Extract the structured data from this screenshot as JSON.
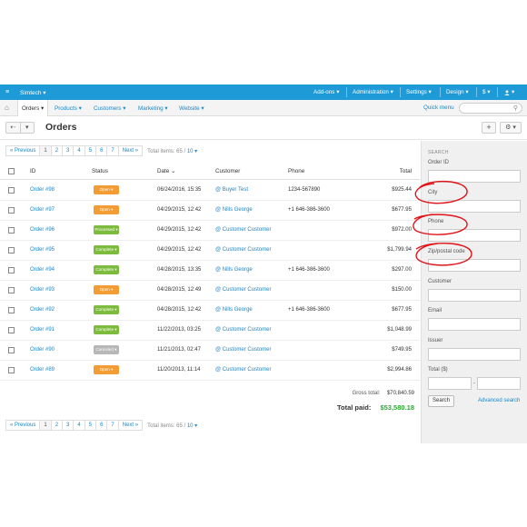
{
  "topbar": {
    "company": "Simtech ▾",
    "addons": "Add-ons ▾",
    "administration": "Administration ▾",
    "settings": "Settings ▾",
    "design": "Design ▾",
    "currency": "$ ▾",
    "user": "▾"
  },
  "subnav": {
    "items": [
      "Orders ▾",
      "Products ▾",
      "Customers ▾",
      "Marketing ▾",
      "Website ▾"
    ],
    "quick_menu": "Quick menu"
  },
  "page": {
    "title": "Orders"
  },
  "pagination": {
    "prev": "« Previous",
    "pages": [
      "1",
      "2",
      "3",
      "4",
      "5",
      "6",
      "7"
    ],
    "next": "Next »",
    "total_label": "Total items: 65 /",
    "per_page": "10 ▾"
  },
  "table": {
    "headers": {
      "id": "ID",
      "status": "Status",
      "date": "Date ⌄",
      "customer": "Customer",
      "phone": "Phone",
      "total": "Total"
    },
    "rows": [
      {
        "id": "Order #98",
        "status": "Open ▾",
        "status_type": "open",
        "date": "06/24/2016, 15:35",
        "customer": "@ Buyer Test",
        "phone": "1234-567890",
        "total": "$925.44"
      },
      {
        "id": "Order #97",
        "status": "Open ▾",
        "status_type": "open",
        "date": "04/29/2015, 12:42",
        "customer": "@ Nills George",
        "phone": "+1 646-386-3600",
        "total": "$677.95"
      },
      {
        "id": "Order #96",
        "status": "Processed ▾",
        "status_type": "processed",
        "date": "04/29/2015, 12:42",
        "customer": "@ Customer Customer",
        "phone": "",
        "total": "$972.00"
      },
      {
        "id": "Order #95",
        "status": "Complete ▾",
        "status_type": "complete",
        "date": "04/29/2015, 12:42",
        "customer": "@ Customer Customer",
        "phone": "",
        "total": "$1,799.94"
      },
      {
        "id": "Order #94",
        "status": "Complete ▾",
        "status_type": "complete",
        "date": "04/28/2015, 13:35",
        "customer": "@ Nills George",
        "phone": "+1 646-386-3600",
        "total": "$297.00"
      },
      {
        "id": "Order #93",
        "status": "Open ▾",
        "status_type": "open",
        "date": "04/28/2015, 12:49",
        "customer": "@ Customer Customer",
        "phone": "",
        "total": "$150.00"
      },
      {
        "id": "Order #92",
        "status": "Complete ▾",
        "status_type": "complete",
        "date": "04/28/2015, 12:42",
        "customer": "@ Nills George",
        "phone": "+1 646-386-3600",
        "total": "$677.95"
      },
      {
        "id": "Order #91",
        "status": "Complete ▾",
        "status_type": "complete",
        "date": "11/22/2013, 03:25",
        "customer": "@ Customer Customer",
        "phone": "",
        "total": "$1,048.99"
      },
      {
        "id": "Order #90",
        "status": "Canceled ▾",
        "status_type": "canceled",
        "date": "11/21/2013, 02:47",
        "customer": "@ Customer Customer",
        "phone": "",
        "total": "$749.95"
      },
      {
        "id": "Order #89",
        "status": "Open ▾",
        "status_type": "open",
        "date": "11/20/2013, 11:14",
        "customer": "@ Customer Customer",
        "phone": "",
        "total": "$2,994.86"
      }
    ]
  },
  "totals": {
    "gross_label": "Gross total:",
    "gross_value": "$70,840.59",
    "paid_label": "Total paid:",
    "paid_value": "$53,580.18"
  },
  "sidebar": {
    "title": "SEARCH",
    "fields": [
      "Order ID",
      "City",
      "Phone",
      "Zip/postal code",
      "Customer",
      "Email",
      "Issuer"
    ],
    "total_label": "Total ($)",
    "search_button": "Search",
    "advanced_search": "Advanced search"
  },
  "colors": {
    "topbar": "#1e9ad6",
    "link": "#1a87c9",
    "open": "#f39c34",
    "complete": "#7dbb3f",
    "canceled": "#b7b7b7",
    "paid": "#2da832",
    "annotation": "#e0151a"
  }
}
